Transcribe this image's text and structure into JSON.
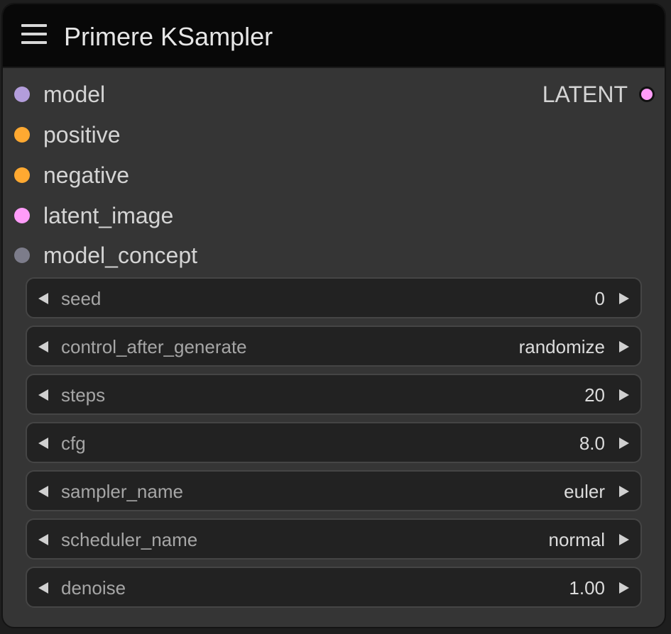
{
  "node": {
    "title": "Primere KSampler",
    "inputs": [
      {
        "label": "model",
        "color": "#b39ddb"
      },
      {
        "label": "positive",
        "color": "#ffa931"
      },
      {
        "label": "negative",
        "color": "#ffa931"
      },
      {
        "label": "latent_image",
        "color": "#ff9cf9"
      },
      {
        "label": "model_concept",
        "color": "#7c7c8a"
      }
    ],
    "outputs": [
      {
        "label": "LATENT",
        "color": "#ff9cf9"
      }
    ],
    "widgets": [
      {
        "label": "seed",
        "value": "0"
      },
      {
        "label": "control_after_generate",
        "value": "randomize"
      },
      {
        "label": "steps",
        "value": "20"
      },
      {
        "label": "cfg",
        "value": "8.0"
      },
      {
        "label": "sampler_name",
        "value": "euler"
      },
      {
        "label": "scheduler_name",
        "value": "normal"
      },
      {
        "label": "denoise",
        "value": "1.00"
      }
    ]
  }
}
